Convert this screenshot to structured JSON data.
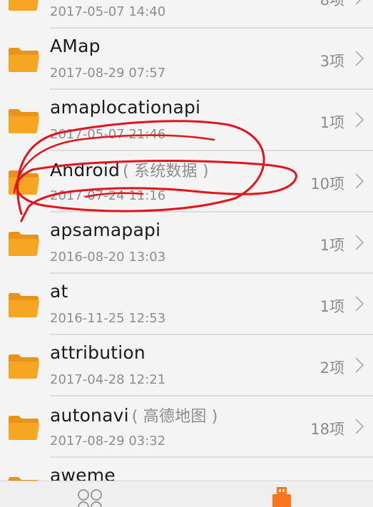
{
  "files": [
    {
      "name": "",
      "suffix": "",
      "date": "2017-05-07 14:40",
      "count": "8项"
    },
    {
      "name": "AMap",
      "suffix": "",
      "date": "2017-08-29 07:57",
      "count": "3项"
    },
    {
      "name": "amaplocationapi",
      "suffix": "",
      "date": "2017-05-07 21:46",
      "count": "1项"
    },
    {
      "name": "Android",
      "suffix": "( 系统数据 )",
      "date": "2017-07-24 11:16",
      "count": "10项"
    },
    {
      "name": "apsamapapi",
      "suffix": "",
      "date": "2016-08-20 13:03",
      "count": "1项"
    },
    {
      "name": "at",
      "suffix": "",
      "date": "2016-11-25 12:53",
      "count": "1项"
    },
    {
      "name": "attribution",
      "suffix": "",
      "date": "2017-04-28 12:21",
      "count": "2项"
    },
    {
      "name": "autonavi",
      "suffix": "( 高德地图 )",
      "date": "2017-08-29 03:32",
      "count": "18项"
    },
    {
      "name": "aweme",
      "suffix": "",
      "date": "",
      "count": ""
    }
  ],
  "icons": {
    "folder": "folder-icon",
    "chevron": "chevron-right-icon",
    "tab_left": "categories-icon",
    "tab_right": "usb-storage-icon"
  },
  "colors": {
    "folder": "#f6a623",
    "annotation": "#e3141b",
    "usb": "#f7771a"
  }
}
